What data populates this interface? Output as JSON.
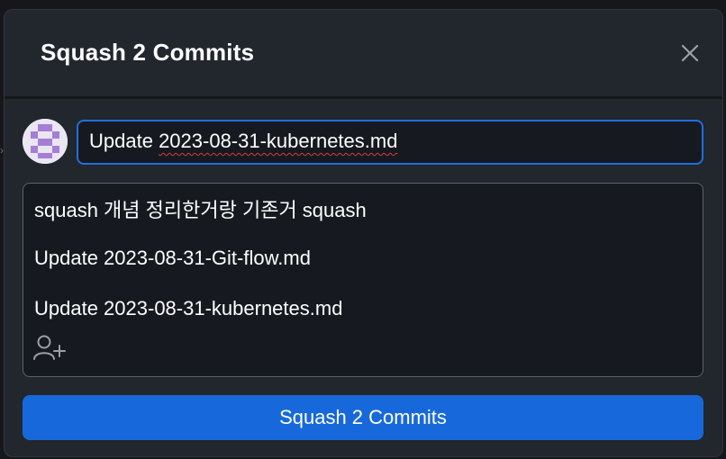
{
  "dialog": {
    "title": "Squash 2 Commits",
    "close_icon": "close-icon"
  },
  "commit": {
    "title_value": "Update 2023-08-31-kubernetes.md",
    "title_prefix": "Update ",
    "title_misspelled": "2023-08-31-kubernetes.md",
    "description_lines": [
      "squash 개념 정리한거랑 기존거 squash",
      "Update 2023-08-31-Git-flow.md",
      "Update 2023-08-31-kubernetes.md"
    ],
    "coauthor_icon": "add-coauthor-icon"
  },
  "actions": {
    "squash_label": "Squash 2 Commits"
  },
  "colors": {
    "accent": "#1769db",
    "focus_border": "#1f6fe0",
    "dialog_bg": "#22262d",
    "input_bg": "#161a20"
  }
}
